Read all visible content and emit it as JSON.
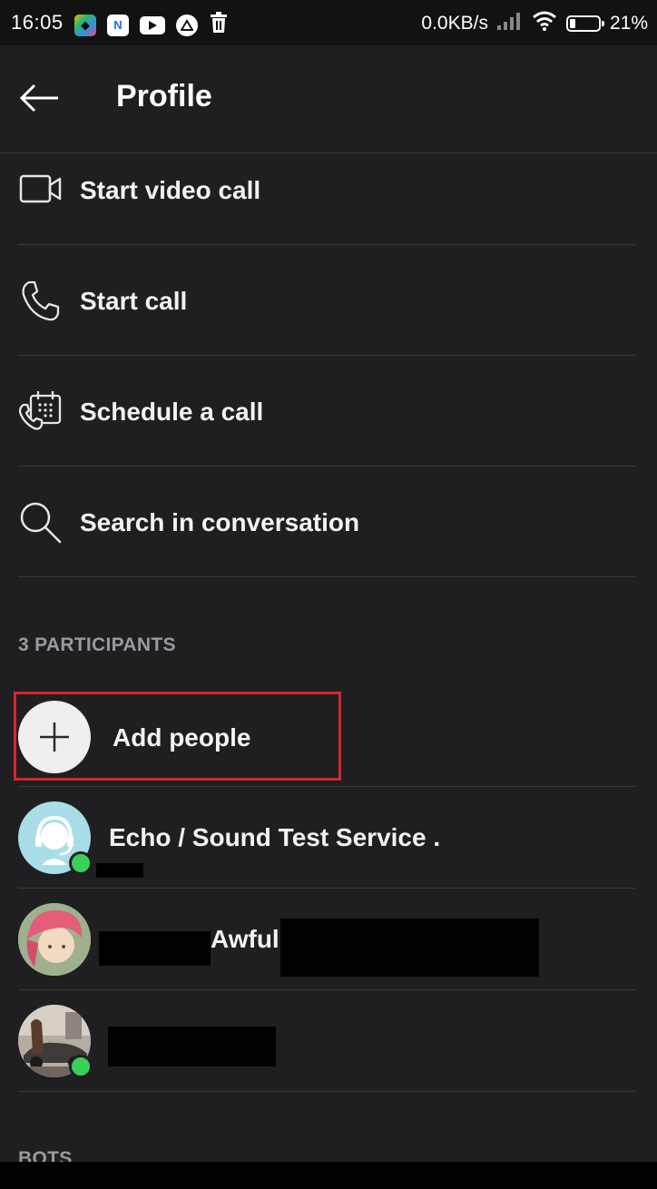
{
  "status_bar": {
    "time": "16:05",
    "speed": "0.0KB/s",
    "battery": "21%",
    "battery_level": 0.21,
    "app_icons": [
      "photos-icon",
      "n-app-icon",
      "youtube-icon",
      "triangle-app-icon",
      "trash-icon"
    ]
  },
  "header": {
    "title": "Profile",
    "back_icon": "arrow-left-icon"
  },
  "actions": [
    {
      "label": "Start video call",
      "icon": "video-camera-icon"
    },
    {
      "label": "Start call",
      "icon": "phone-icon"
    },
    {
      "label": "Schedule a call",
      "icon": "calendar-phone-icon"
    },
    {
      "label": "Search in conversation",
      "icon": "search-icon"
    }
  ],
  "participants_section": {
    "label": "3 PARTICIPANTS",
    "add_label": "Add people",
    "people": [
      {
        "name": "Echo / Sound Test Service .",
        "online": true
      },
      {
        "name": "Awful",
        "online": false
      },
      {
        "name": "",
        "online": true
      }
    ]
  },
  "bots_section": {
    "label": "BOTS"
  },
  "colors": {
    "background": "#1f1f21",
    "divider": "#3a3a3d",
    "presence": "#3ad05a",
    "highlight": "#d7262f"
  }
}
